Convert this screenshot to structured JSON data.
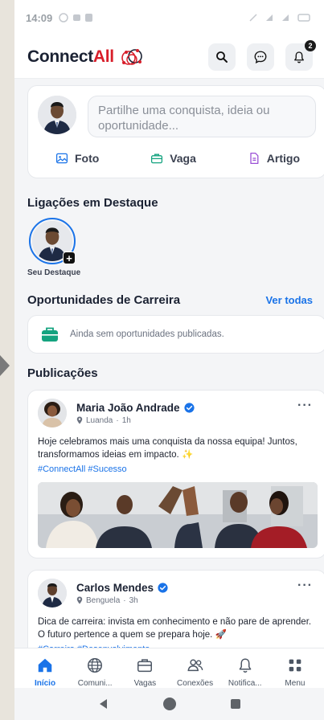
{
  "status": {
    "time": "14:09"
  },
  "brand": {
    "name_part1": "Connect",
    "name_part2": "All"
  },
  "header": {
    "notification_count": "2"
  },
  "composer": {
    "placeholder": "Partilhe uma conquista, ideia ou oportunidade...",
    "actions": [
      {
        "label": "Foto",
        "icon": "image-icon"
      },
      {
        "label": "Vaga",
        "icon": "briefcase-icon"
      },
      {
        "label": "Artigo",
        "icon": "document-icon"
      }
    ]
  },
  "highlights": {
    "title": "Ligações em Destaque",
    "own_label": "Seu Destaque"
  },
  "career": {
    "title": "Oportunidades de Carreira",
    "see_all": "Ver todas",
    "empty_text": "Ainda sem oportunidades publicadas."
  },
  "posts": {
    "title": "Publicações",
    "items": [
      {
        "author": "Maria João Andrade",
        "location": "Luanda",
        "time": "1h",
        "text": "Hoje celebramos mais uma conquista da nossa equipa! Juntos, transformamos ideias em impacto. ✨",
        "tags": "#ConnectAll #Sucesso"
      },
      {
        "author": "Carlos Mendes",
        "location": "Benguela",
        "time": "3h",
        "text": "Dica de carreira: invista em conhecimento e não pare de aprender. O futuro pertence a quem se prepara hoje. 🚀",
        "tags": "#Carreira #Desenvolvimento"
      }
    ]
  },
  "nav": {
    "items": [
      {
        "label": "Início",
        "icon": "home-icon",
        "active": true
      },
      {
        "label": "Comuni...",
        "icon": "globe-icon"
      },
      {
        "label": "Vagas",
        "icon": "briefcase-icon"
      },
      {
        "label": "Conexões",
        "icon": "people-icon"
      },
      {
        "label": "Notifica...",
        "icon": "bell-icon"
      },
      {
        "label": "Menu",
        "icon": "grid-icon"
      }
    ]
  },
  "colors": {
    "accent": "#1a73e8",
    "brand_red": "#d81e2a",
    "text_dark": "#1b2233"
  }
}
